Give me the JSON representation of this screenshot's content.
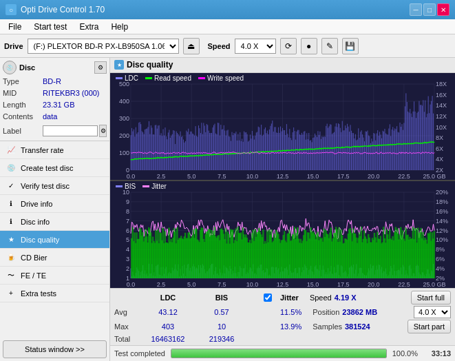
{
  "app": {
    "title": "Opti Drive Control 1.70",
    "title_icon": "●"
  },
  "title_controls": {
    "minimize": "─",
    "maximize": "□",
    "close": "✕"
  },
  "menu": {
    "items": [
      "File",
      "Start test",
      "Extra",
      "Help"
    ]
  },
  "toolbar": {
    "drive_label": "Drive",
    "drive_value": "(F:) PLEXTOR BD-R  PX-LB950SA 1.06",
    "eject_icon": "⏏",
    "speed_label": "Speed",
    "speed_value": "4.0 X",
    "icon1": "⟳",
    "icon2": "●",
    "icon3": "✎",
    "icon4": "💾"
  },
  "disc": {
    "section_label": "Disc",
    "type_label": "Type",
    "type_value": "BD-R",
    "mid_label": "MID",
    "mid_value": "RITEKBR3 (000)",
    "length_label": "Length",
    "length_value": "23.31 GB",
    "contents_label": "Contents",
    "contents_value": "data",
    "label_label": "Label",
    "label_value": ""
  },
  "nav_items": [
    {
      "id": "transfer-rate",
      "label": "Transfer rate",
      "icon": "📈"
    },
    {
      "id": "create-test-disc",
      "label": "Create test disc",
      "icon": "💿"
    },
    {
      "id": "verify-test-disc",
      "label": "Verify test disc",
      "icon": "✓"
    },
    {
      "id": "drive-info",
      "label": "Drive info",
      "icon": "ℹ"
    },
    {
      "id": "disc-info",
      "label": "Disc info",
      "icon": "ℹ"
    },
    {
      "id": "disc-quality",
      "label": "Disc quality",
      "icon": "★",
      "active": true
    },
    {
      "id": "cd-bier",
      "label": "CD Bier",
      "icon": "🍺"
    },
    {
      "id": "fe-te",
      "label": "FE / TE",
      "icon": "~"
    },
    {
      "id": "extra-tests",
      "label": "Extra tests",
      "icon": "+"
    }
  ],
  "status_button": "Status window >>",
  "chart_header": {
    "title": "Disc quality",
    "icon": "★"
  },
  "top_chart": {
    "legend": [
      {
        "label": "LDC",
        "color": "#8080ff"
      },
      {
        "label": "Read speed",
        "color": "#00ff00"
      },
      {
        "label": "Write speed",
        "color": "#ff00ff"
      }
    ],
    "y_left": [
      "500",
      "400",
      "300",
      "200",
      "100",
      "0.0"
    ],
    "y_right": [
      "18X",
      "16X",
      "14X",
      "12X",
      "10X",
      "8X",
      "6X",
      "4X",
      "2X"
    ],
    "x_labels": [
      "0.0",
      "2.5",
      "5.0",
      "7.5",
      "10.0",
      "12.5",
      "15.0",
      "17.5",
      "20.0",
      "22.5",
      "25.0 GB"
    ]
  },
  "bottom_chart": {
    "legend": [
      {
        "label": "BIS",
        "color": "#8080ff"
      },
      {
        "label": "Jitter",
        "color": "#ff80ff"
      }
    ],
    "y_left": [
      "10",
      "9",
      "8",
      "7",
      "6",
      "5",
      "4",
      "3",
      "2",
      "1"
    ],
    "y_right": [
      "20%",
      "18%",
      "16%",
      "14%",
      "12%",
      "10%",
      "8%",
      "6%",
      "4%",
      "2%"
    ],
    "x_labels": [
      "0.0",
      "2.5",
      "5.0",
      "7.5",
      "10.0",
      "12.5",
      "15.0",
      "17.5",
      "20.0",
      "22.5",
      "25.0 GB"
    ]
  },
  "stats": {
    "headers": [
      "LDC",
      "BIS",
      "",
      "Jitter",
      "Speed",
      ""
    ],
    "avg_label": "Avg",
    "avg_ldc": "43.12",
    "avg_bis": "0.57",
    "avg_jitter": "11.5%",
    "max_label": "Max",
    "max_ldc": "403",
    "max_bis": "10",
    "max_jitter": "13.9%",
    "total_label": "Total",
    "total_ldc": "16463162",
    "total_bis": "219346",
    "speed_val": "4.19 X",
    "speed_set": "4.0 X",
    "position_label": "Position",
    "position_val": "23862 MB",
    "samples_label": "Samples",
    "samples_val": "381524",
    "jitter_checked": true,
    "btn_start_full": "Start full",
    "btn_start_part": "Start part"
  },
  "status_bar": {
    "text": "Test completed",
    "progress": 100,
    "time": "33:13"
  }
}
